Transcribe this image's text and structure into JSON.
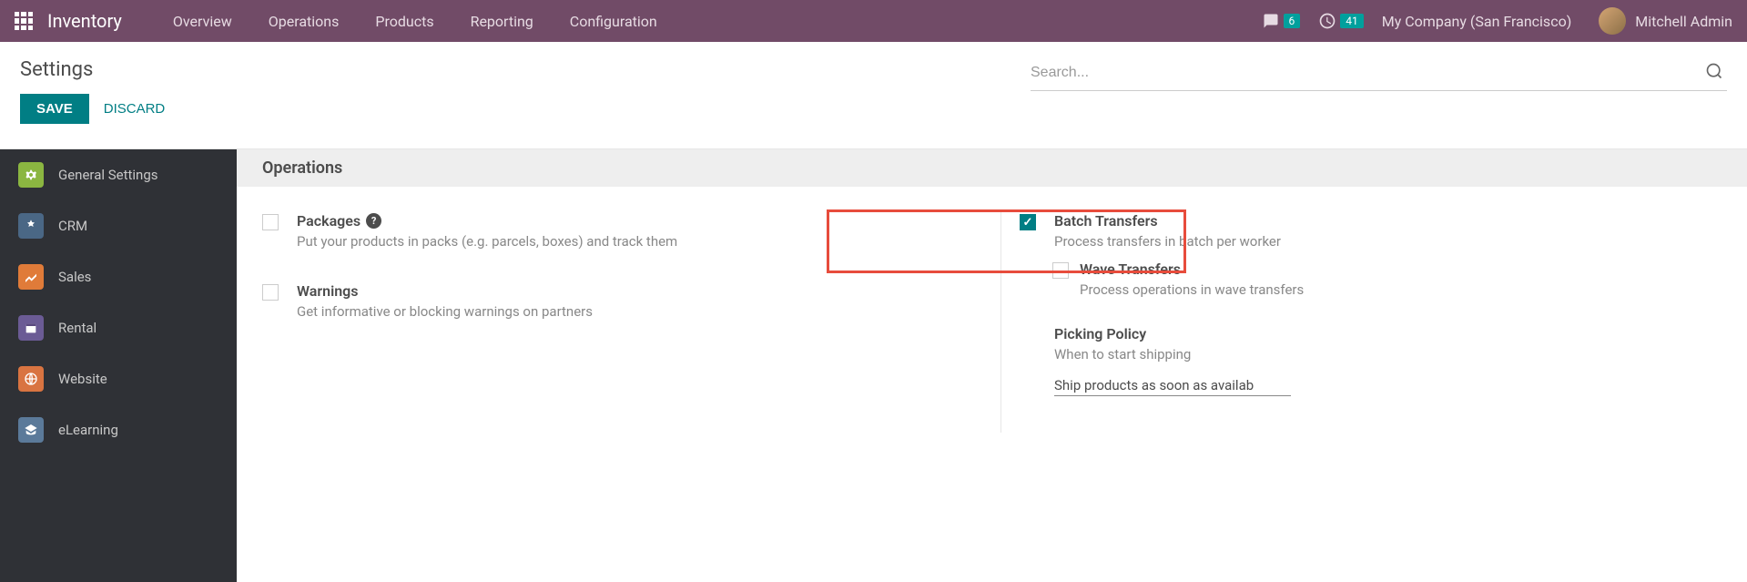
{
  "topbar": {
    "brand": "Inventory",
    "nav": [
      "Overview",
      "Operations",
      "Products",
      "Reporting",
      "Configuration"
    ],
    "messages_badge": "6",
    "activities_badge": "41",
    "company": "My Company (San Francisco)",
    "user": "Mitchell Admin"
  },
  "header": {
    "title": "Settings",
    "save_label": "SAVE",
    "discard_label": "DISCARD",
    "search_placeholder": "Search..."
  },
  "sidebar": {
    "items": [
      {
        "label": "General Settings"
      },
      {
        "label": "CRM"
      },
      {
        "label": "Sales"
      },
      {
        "label": "Rental"
      },
      {
        "label": "Website"
      },
      {
        "label": "eLearning"
      }
    ]
  },
  "section": {
    "title": "Operations"
  },
  "settings": {
    "packages": {
      "title": "Packages",
      "desc": "Put your products in packs (e.g. parcels, boxes) and track them"
    },
    "batch": {
      "title": "Batch Transfers",
      "desc": "Process transfers in batch per worker"
    },
    "wave": {
      "title": "Wave Transfers",
      "desc": "Process operations in wave transfers"
    },
    "warnings": {
      "title": "Warnings",
      "desc": "Get informative or blocking warnings on partners"
    },
    "picking": {
      "title": "Picking Policy",
      "desc": "When to start shipping",
      "value": "Ship products as soon as availab"
    }
  }
}
